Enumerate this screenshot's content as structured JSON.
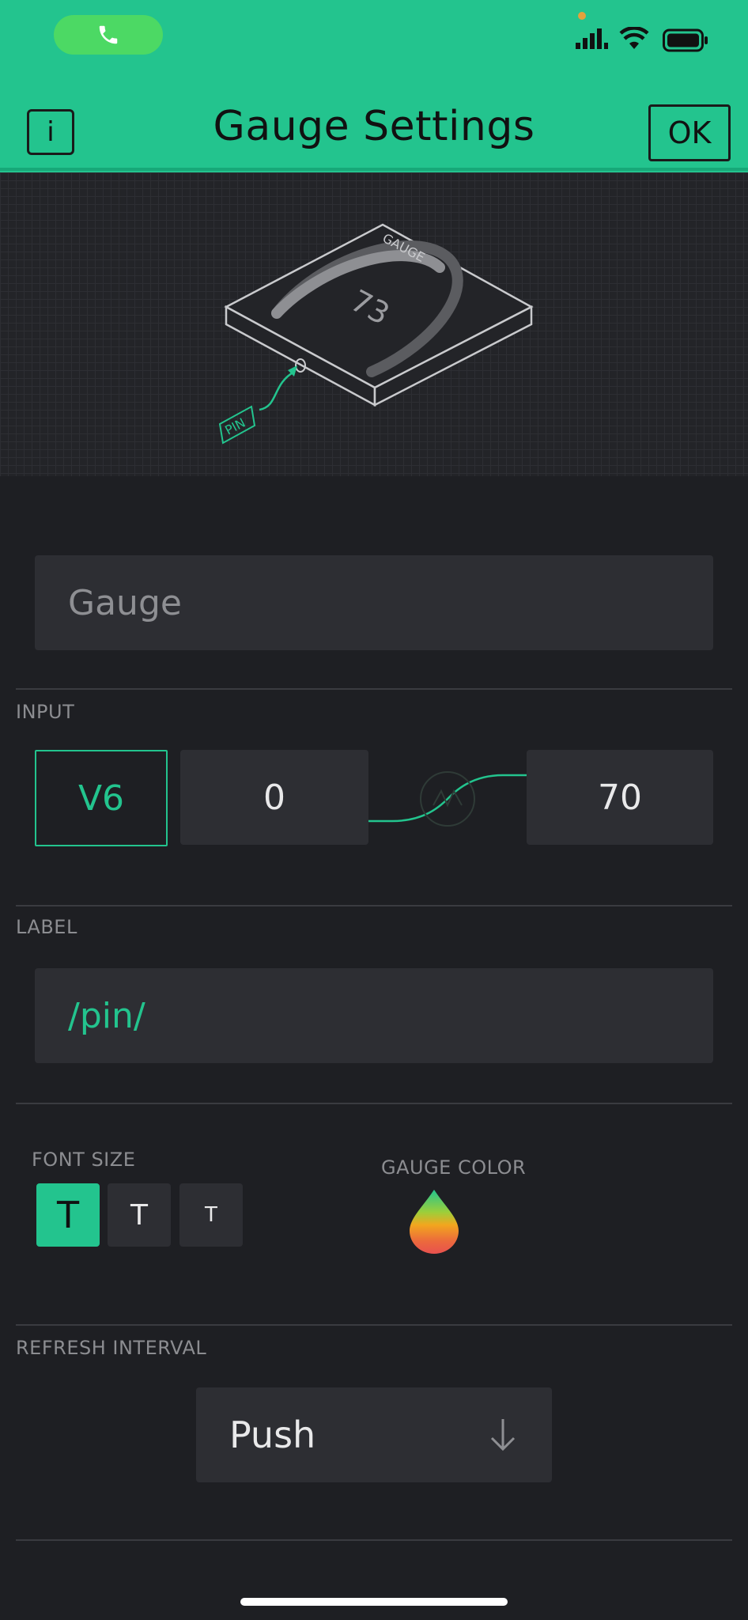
{
  "status_bar": {
    "call_icon": "phone-icon",
    "signal_icon": "cellular-signal-icon",
    "wifi_icon": "wifi-icon",
    "battery_icon": "battery-icon"
  },
  "header": {
    "info_label": "i",
    "title": "Gauge Settings",
    "ok_label": "OK"
  },
  "illustration": {
    "widget_caption": "GAUGE",
    "gauge_value": "73",
    "pin_caption": "PIN"
  },
  "name_field": {
    "value": "Gauge"
  },
  "input": {
    "section_label": "INPUT",
    "pin": "V6",
    "min": "0",
    "max": "70"
  },
  "label": {
    "section_label": "LABEL",
    "value": "/pin/"
  },
  "font_size": {
    "section_label": "FONT SIZE",
    "options": [
      "T",
      "T",
      "T"
    ],
    "selected_index": 0
  },
  "gauge_color": {
    "section_label": "GAUGE COLOR",
    "icon": "color-drop-icon"
  },
  "refresh_interval": {
    "section_label": "REFRESH INTERVAL",
    "selected": "Push",
    "icon": "arrow-down-icon"
  },
  "colors": {
    "accent": "#23c48e",
    "background": "#1e1f23",
    "field": "#2d2e33"
  }
}
